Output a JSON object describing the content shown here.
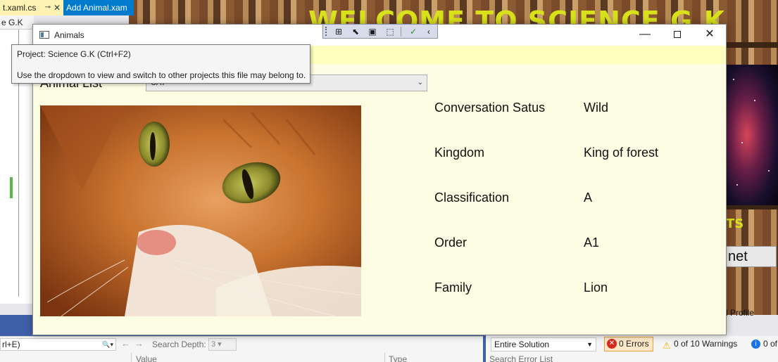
{
  "ide": {
    "tabs": [
      {
        "label": "t.xaml.cs"
      },
      {
        "label": "Add Animal.xam"
      }
    ],
    "breadcrumb": "e G.K",
    "search_field": "rl+E)",
    "search_depth_label": "Search Depth:",
    "search_depth_value": "3",
    "columns": {
      "value": "Value",
      "type": "Type"
    },
    "error_list": {
      "scope": "Entire Solution",
      "errors": "0 Errors",
      "warnings": "0 of 10 Warnings",
      "messages": "0 of",
      "search_placeholder": "Search Error List"
    },
    "profile_label": "l Profile"
  },
  "preview": {
    "welcome_text": "WELCOME TO SCIENCE G.K",
    "yellow_fragment": "TS",
    "button_fragment": "net"
  },
  "animals_window": {
    "title": "Animals",
    "tooltip": {
      "line1": "Project: Science G.K (Ctrl+F2)",
      "line2": "Use the dropdown to view and switch to other projects this file may belong to."
    },
    "animal_list_label": "Animal List",
    "selected_animal": "CAT",
    "details": [
      {
        "label": "Conversation Satus",
        "value": "Wild"
      },
      {
        "label": "Kingdom",
        "value": "King of forest"
      },
      {
        "label": "Classification",
        "value": "A"
      },
      {
        "label": "Order",
        "value": "A1"
      },
      {
        "label": "Family",
        "value": "Lion"
      }
    ]
  },
  "colors": {
    "window_bg": "#fdfde3",
    "accent": "#007acc",
    "welcome": "#d8e21a"
  }
}
